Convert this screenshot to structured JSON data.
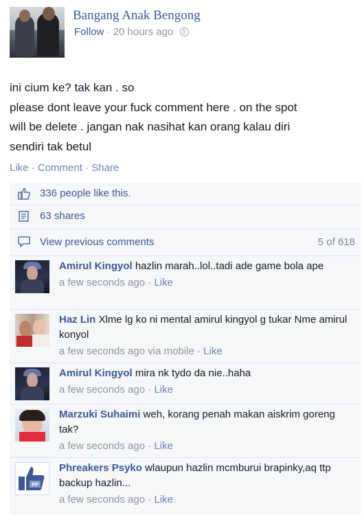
{
  "post": {
    "author": "Bangang Anak Bengong",
    "follow_label": "Follow",
    "separator": "·",
    "time": "20 hours ago",
    "text_lines": [
      "ini cium ke? tak kan . so",
      "please dont leave your fuck comment here . on the spot",
      "will be delete . jangan nak nasihat kan orang kalau diri",
      "sendiri tak betul"
    ]
  },
  "actions": {
    "like": "Like",
    "comment": "Comment",
    "share": "Share",
    "dot": "·"
  },
  "stats": {
    "likes": "336 people like this.",
    "shares": "63 shares",
    "view_previous": "View previous comments",
    "comment_count": "5 of 618"
  },
  "comments": [
    {
      "name": "Amirul Kingyol",
      "text": "hazlin marah..lol..tadi ade game bola ape",
      "time": "a few seconds ago",
      "via": "",
      "like": "Like"
    },
    {
      "name": "Haz Lin",
      "text": "Xlme lg ko ni mental amirul kingyol g tukar Nme amirul konyol",
      "time": "a few seconds ago",
      "via": "via mobile",
      "like": "Like"
    },
    {
      "name": "Amirul Kingyol",
      "text": "mira nk tydo da nie..haha",
      "time": "a few seconds ago",
      "via": "",
      "like": "Like"
    },
    {
      "name": "Marzuki Suhaimi",
      "text": "weh, korang penah makan aiskrim goreng tak?",
      "time": "a few seconds ago",
      "via": "",
      "like": "Like"
    },
    {
      "name": "Phreakers Psyko",
      "text": "wlaupun hazlin mcmburui brapinky,aq ttp backup hazlin...",
      "time": "a few seconds ago",
      "via": "",
      "like": "Like"
    }
  ],
  "colors": {
    "link": "#3b5998",
    "muted": "#90949c",
    "panel": "#f6f7f9"
  }
}
